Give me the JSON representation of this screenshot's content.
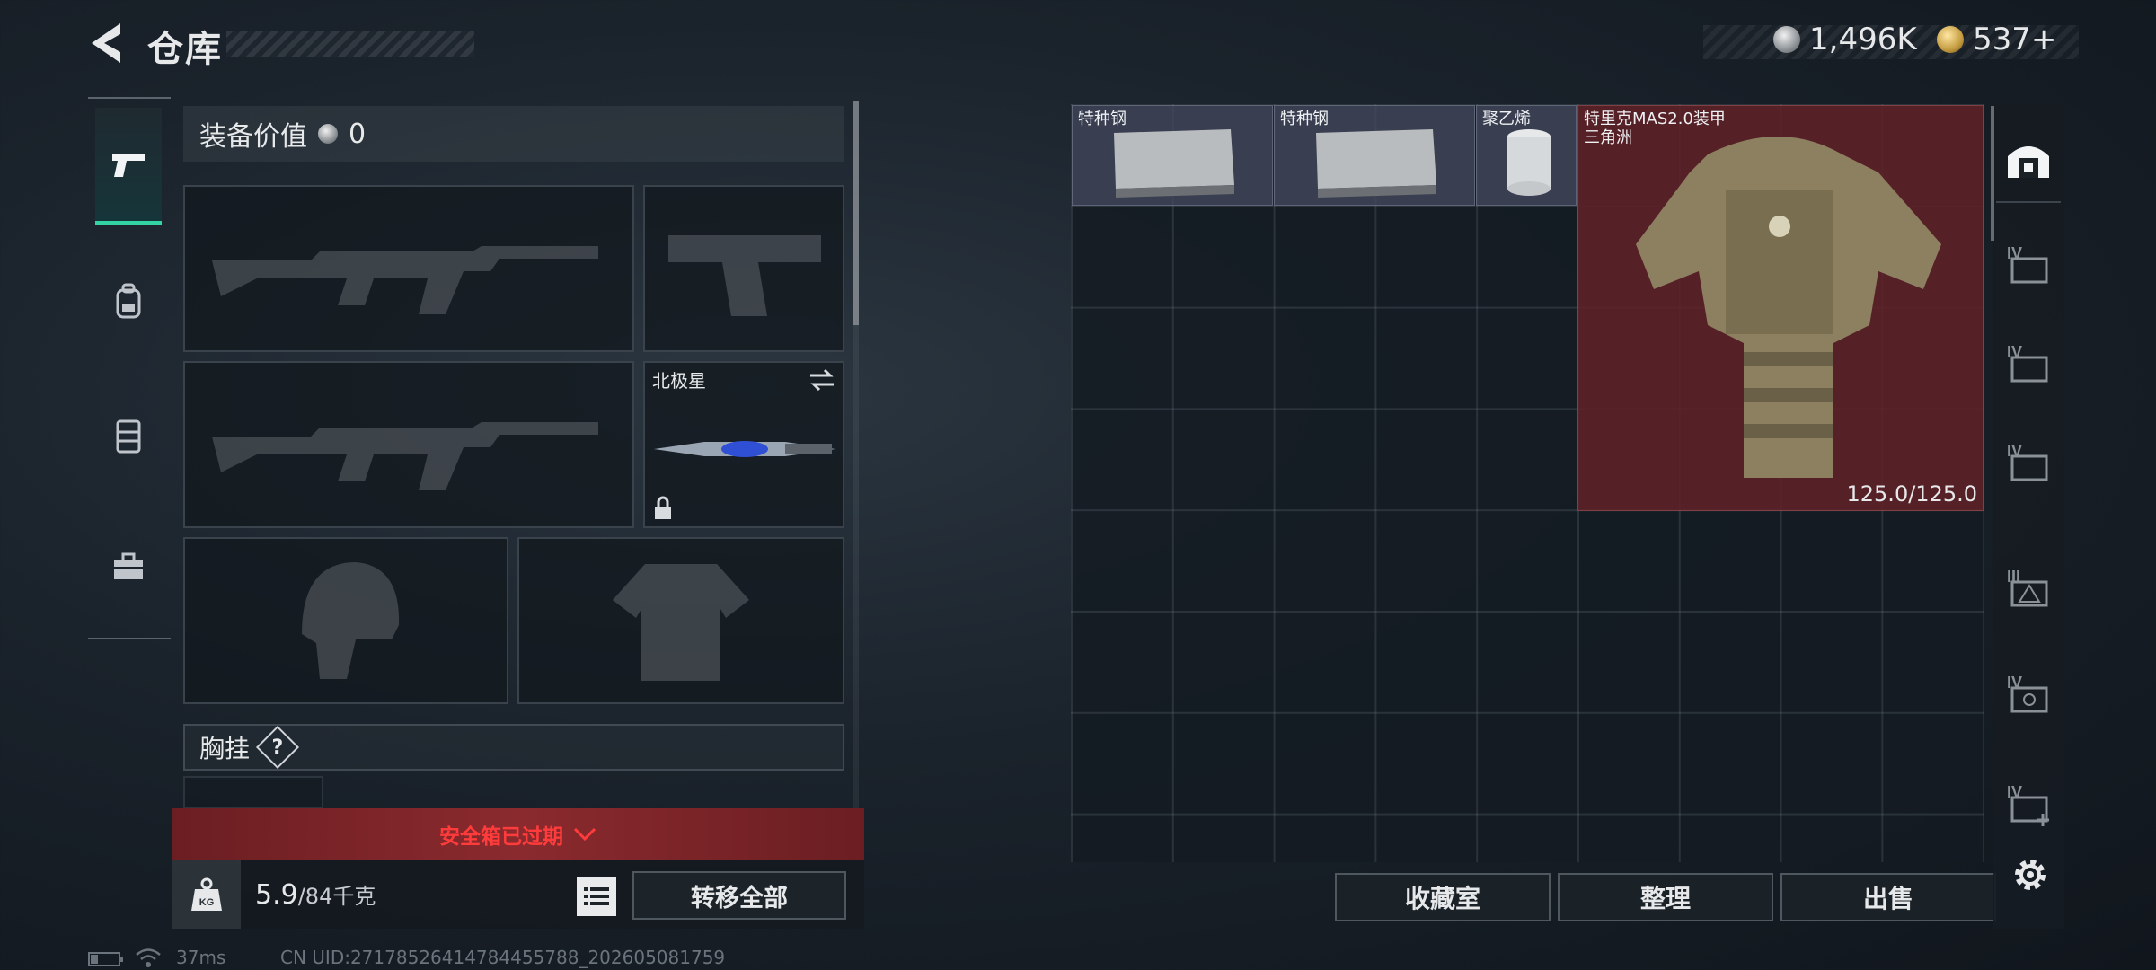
{
  "header": {
    "title": "仓库",
    "currencies": [
      {
        "icon": "silver-coin-icon",
        "value": "1,496K"
      },
      {
        "icon": "gold-coin-icon",
        "value": "537+"
      }
    ]
  },
  "tabs": [
    {
      "icon": "pistol-icon",
      "active": true
    },
    {
      "icon": "backpack-icon",
      "active": false
    },
    {
      "icon": "vest-icon",
      "active": false
    },
    {
      "icon": "toolbox-icon",
      "active": false
    }
  ],
  "equipment": {
    "value_label": "装备价值",
    "value": "0",
    "melee_name": "北极星",
    "chest_label": "胸挂",
    "help_mark": "?"
  },
  "safe_box": {
    "text": "安全箱已过期"
  },
  "bottom_left": {
    "weight_badge": "KG",
    "weight_current": "5.9",
    "weight_max": "/84千克",
    "transfer_all": "转移全部"
  },
  "storage": {
    "items": [
      {
        "name": "特种钢"
      },
      {
        "name": "特种钢"
      },
      {
        "name": "聚乙烯"
      },
      {
        "name": "特里克MAS2.0装甲",
        "subtitle": "三角洲",
        "durability": "125.0/125.0"
      }
    ],
    "buttons": {
      "collection": "收藏室",
      "organize": "整理",
      "sell": "出售"
    }
  },
  "sidebar_right": {
    "tiers": [
      "IV",
      "IV",
      "IV",
      "III",
      "IV",
      "IV"
    ]
  },
  "status_bar": {
    "ping": "37ms",
    "uid": "CN UID:27178526414784455788_202605081759"
  },
  "colors": {
    "accent": "#34d3a4",
    "warning_red": "#ff3b3b",
    "armor_cell": "#62212a",
    "item_cell": "#42485c"
  }
}
